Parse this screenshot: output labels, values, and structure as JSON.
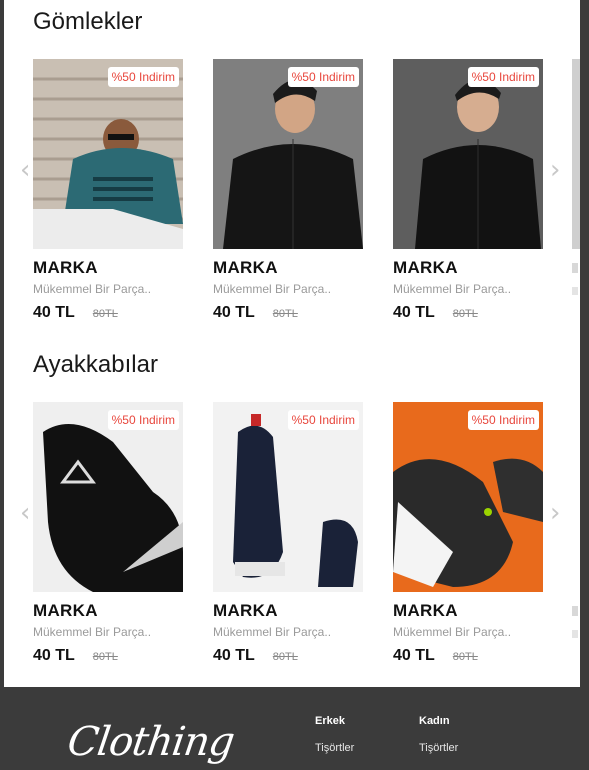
{
  "sections": [
    {
      "title": "Gömlekler",
      "products": [
        {
          "badge": "%50 Indirim",
          "brand": "MARKA",
          "desc": "Mükemmel Bir Parça..",
          "price": "40 TL",
          "old_price": "80TL"
        },
        {
          "badge": "%50 Indirim",
          "brand": "MARKA",
          "desc": "Mükemmel Bir Parça..",
          "price": "40 TL",
          "old_price": "80TL"
        },
        {
          "badge": "%50 Indirim",
          "brand": "MARKA",
          "desc": "Mükemmel Bir Parça..",
          "price": "40 TL",
          "old_price": "80TL"
        }
      ]
    },
    {
      "title": "Ayakkabılar",
      "products": [
        {
          "badge": "%50 Indirim",
          "brand": "MARKA",
          "desc": "Mükemmel Bir Parça..",
          "price": "40 TL",
          "old_price": "80TL"
        },
        {
          "badge": "%50 Indirim",
          "brand": "MARKA",
          "desc": "Mükemmel Bir Parça..",
          "price": "40 TL",
          "old_price": "80TL"
        },
        {
          "badge": "%50 Indirim",
          "brand": "MARKA",
          "desc": "Mükemmel Bir Parça..",
          "price": "40 TL",
          "old_price": "80TL"
        }
      ]
    }
  ],
  "arrows": {
    "prev": "‹",
    "next": "›"
  },
  "footer": {
    "logo": "Clothing",
    "columns": [
      {
        "heading": "Erkek",
        "link": "Tişörtler"
      },
      {
        "heading": "Kadın",
        "link": "Tişörtler"
      }
    ]
  },
  "colors": {
    "badge_text": "#e8463c",
    "footer_bg": "#3b3b3b",
    "shoe3_bg": "#e86a1c"
  }
}
